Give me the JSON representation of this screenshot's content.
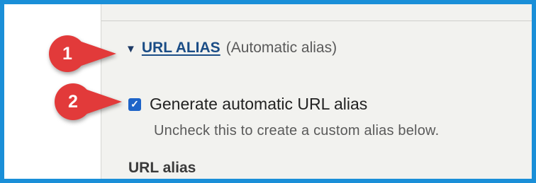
{
  "colors": {
    "frame_border": "#1a8fd8",
    "panel_background": "#f2f2ef",
    "link": "#1b4d86",
    "checkbox": "#1e64c8",
    "callout": "#e23a3a"
  },
  "section": {
    "caret_icon": "triangle-down",
    "title": "URL ALIAS",
    "note": "(Automatic alias)"
  },
  "checkbox": {
    "checked": true,
    "label": "Generate automatic URL alias",
    "description": "Uncheck this to create a custom alias below."
  },
  "field": {
    "label": "URL alias"
  },
  "callouts": [
    {
      "number": "1"
    },
    {
      "number": "2"
    }
  ]
}
